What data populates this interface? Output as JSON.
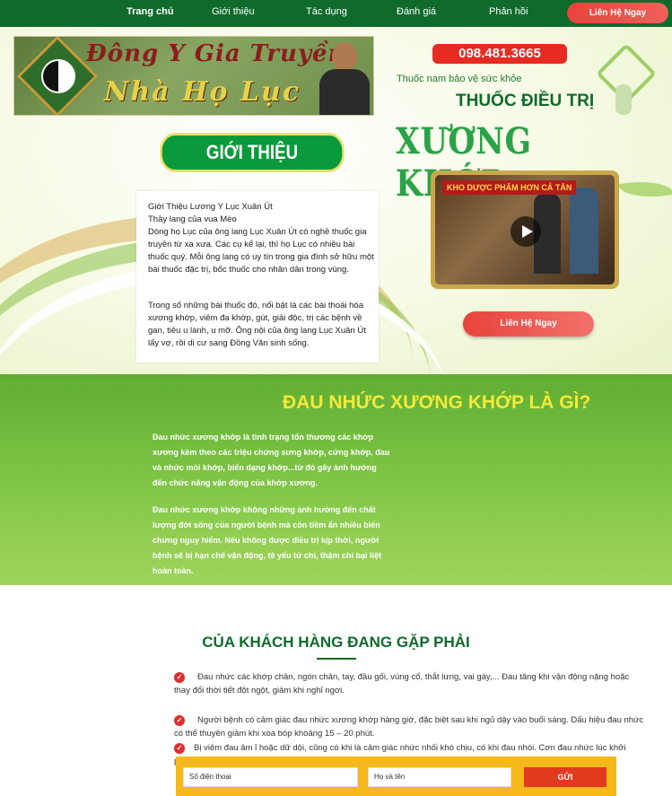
{
  "nav": {
    "items": [
      "Trang chủ",
      "Giới thiệu",
      "Tác dụng",
      "Đánh giá",
      "Phản hồi"
    ],
    "cta": "Liên Hệ Ngay"
  },
  "logo": {
    "line1": "Đông Y Gia Truyền",
    "line2": "Nhà Họ Lục"
  },
  "intro": {
    "title": "GIỚI THIỆU",
    "paragraphs": [
      "Giới Thiệu Lương Y Lục Xuân Út",
      "Thầy lang của vua Mèo",
      "Dòng họ Lục của ông lang Lục Xuân Út có nghề thuốc gia truyền từ xa xưa. Các cụ kể lại, thì họ Lục có nhiều bài thuốc quý. Mỗi ông lang có uy tín trong gia đình sở hữu một bài thuốc đặc trị, bốc thuốc cho nhân dân trong vùng.",
      "Trong số những bài thuốc đó, nổi bật là các bài thoái hóa xương khớp, viêm đa khớp, gút, giải độc, trị các bệnh về gan, tiêu u lành, u mỡ. Ông nội của ông lang Lục Xuân Út lấy vợ, rồi di cư sang Đồng Văn sinh sống."
    ]
  },
  "hero": {
    "phone": "098.481.3665",
    "tagline": "Thuốc nam bảo vệ sức khỏe",
    "treat": "THUỐC ĐIỀU TRỊ",
    "product": "XƯƠNG KHỚP",
    "video_badge": "KHO DƯỢC PHẨM HƠN CẢ TẤN",
    "cta": "Liên Hệ Ngay"
  },
  "about": {
    "title": "ĐAU NHỨC XƯƠNG KHỚP LÀ GÌ?",
    "p1": "Đau nhức xương khớp là tình trạng tổn thương các khớp xương kèm theo các triệu chứng sưng khớp, cứng khớp, đau và nhức mỏi khớp, biến dạng khớp...từ đó gây ảnh hưởng đến chức năng vận động của khớp xương.",
    "p2": "Đau nhức xương khớp không những ảnh hưởng đến chất lượng đời sống của người bệnh mà còn tiềm ẩn nhiều biến chứng nguy hiểm. Nếu không được điều trị kịp thời, người bệnh sẽ bị hạn chế vận động, tê yếu tứ chi, thậm chí bại liệt hoàn toàn."
  },
  "customers": {
    "title": "CỦA KHÁCH HÀNG ĐANG GẶP PHẢI",
    "items": [
      "Đau nhức các khớp chân, ngón chân, tay, đầu gối, vùng cổ, thắt lưng, vai gáy,... Đau tăng khi vận động nặng hoặc thay đổi thời tiết đột ngột, giảm khi nghỉ ngơi.",
      "Người bệnh có cảm giác đau nhức xương khớp hàng giờ, đặc biệt sau khi ngủ dậy vào buổi sáng. Dấu hiệu đau nhức có thể thuyên giảm khi xoa bóp khoảng 15 – 20 phút.",
      "Bị viêm đau âm ỉ hoặc dữ dội, cũng có khi là cảm giác nhức nhối khó chịu, có khi đau nhói. Cơn đau nhức lúc khởi phát"
    ]
  },
  "form": {
    "phone_placeholder": "Số điện thoại",
    "name_placeholder": "Họ và tên",
    "submit": "GỬI"
  }
}
